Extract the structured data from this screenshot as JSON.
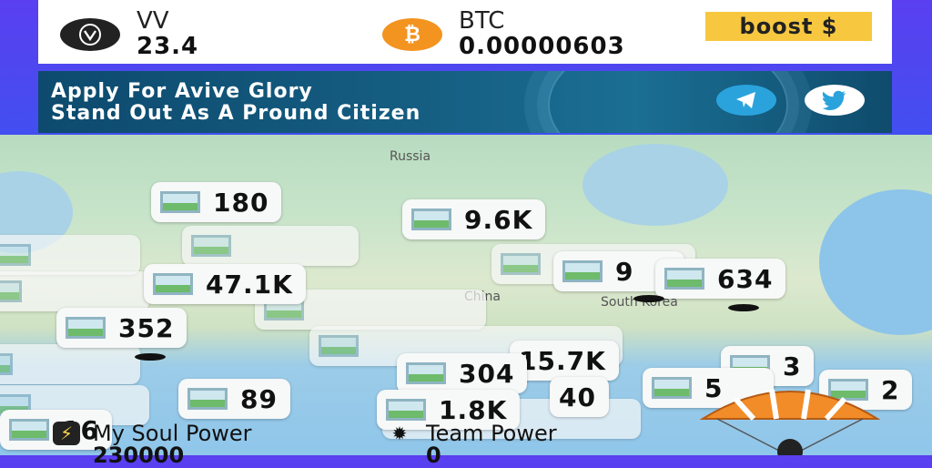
{
  "wallet": {
    "vv": {
      "icon": "vv-logo-icon",
      "name": "VV",
      "value": "23.4"
    },
    "btc": {
      "icon": "bitcoin-icon",
      "name": "BTC",
      "value": "0.00000603"
    },
    "boost_label": "boost $"
  },
  "banner": {
    "line1": "Apply For Avive Glory",
    "line2": "Stand Out As A Pround Citizen",
    "telegram_icon": "telegram-icon",
    "twitter_icon": "twitter-icon"
  },
  "map": {
    "labels": [
      "Russia",
      "China",
      "South Korea"
    ],
    "pills": [
      {
        "value": "180"
      },
      {
        "value": "9.6K"
      },
      {
        "value": "634"
      },
      {
        "value": "352"
      },
      {
        "value": "89"
      },
      {
        "value": "304"
      },
      {
        "value": "1.8K"
      },
      {
        "value": "15.7K"
      },
      {
        "value": "3"
      },
      {
        "value": "2"
      },
      {
        "value": "5"
      },
      {
        "value": "9"
      },
      {
        "value": "47.1K"
      },
      {
        "value": "40"
      },
      {
        "value": "16"
      }
    ]
  },
  "power": {
    "soul_label": "My Soul Power",
    "soul_value": "230000",
    "team_label": "Team Power",
    "team_value": "0"
  },
  "colors": {
    "boost_bg": "#f7c740",
    "btc": "#f2941f",
    "banner": "#155e82"
  }
}
